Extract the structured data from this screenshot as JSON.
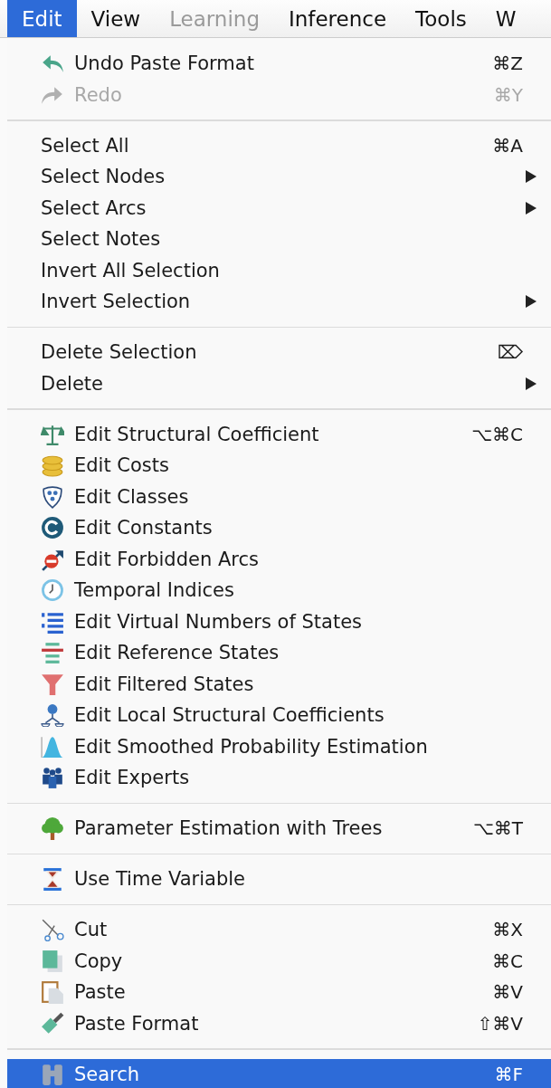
{
  "menubar": [
    {
      "label": "Edit",
      "selected": true,
      "disabled": false
    },
    {
      "label": "View",
      "selected": false,
      "disabled": false
    },
    {
      "label": "Learning",
      "selected": false,
      "disabled": true
    },
    {
      "label": "Inference",
      "selected": false,
      "disabled": false
    },
    {
      "label": "Tools",
      "selected": false,
      "disabled": false
    },
    {
      "label": "W",
      "selected": false,
      "disabled": false
    }
  ],
  "menu": {
    "sections": [
      {
        "items": [
          {
            "kind": "command",
            "label": "Undo Paste Format",
            "shortcut": "⌘Z",
            "disabled": false,
            "selected": false
          },
          {
            "kind": "command",
            "label": "Redo",
            "shortcut": "⌘Y",
            "disabled": true,
            "selected": false
          }
        ]
      },
      {
        "items": [
          {
            "kind": "command",
            "label": "Select All",
            "shortcut": "⌘A",
            "disabled": false,
            "selected": false
          },
          {
            "kind": "submenu",
            "label": "Select Nodes",
            "disabled": false,
            "selected": false
          },
          {
            "kind": "submenu",
            "label": "Select Arcs",
            "disabled": false,
            "selected": false
          },
          {
            "kind": "command",
            "label": "Select Notes",
            "disabled": false,
            "selected": false
          },
          {
            "kind": "command",
            "label": "Invert All Selection",
            "disabled": false,
            "selected": false
          },
          {
            "kind": "submenu",
            "label": "Invert Selection",
            "disabled": false,
            "selected": false
          }
        ]
      },
      {
        "items": [
          {
            "kind": "command",
            "label": "Delete Selection",
            "shortcut": "⌦",
            "disabled": false,
            "selected": false
          },
          {
            "kind": "submenu",
            "label": "Delete",
            "disabled": false,
            "selected": false
          }
        ]
      },
      {
        "items": [
          {
            "kind": "command",
            "label": "Edit Structural Coefficient",
            "shortcut": "⌥⌘C",
            "disabled": false,
            "selected": false
          },
          {
            "kind": "command",
            "label": "Edit Costs",
            "disabled": false,
            "selected": false
          },
          {
            "kind": "command",
            "label": "Edit Classes",
            "disabled": false,
            "selected": false
          },
          {
            "kind": "command",
            "label": "Edit Constants",
            "disabled": false,
            "selected": false
          },
          {
            "kind": "command",
            "label": "Edit Forbidden Arcs",
            "disabled": false,
            "selected": false
          },
          {
            "kind": "command",
            "label": "Temporal Indices",
            "disabled": false,
            "selected": false
          },
          {
            "kind": "command",
            "label": "Edit Virtual Numbers of States",
            "disabled": false,
            "selected": false
          },
          {
            "kind": "command",
            "label": "Edit Reference States",
            "disabled": false,
            "selected": false
          },
          {
            "kind": "command",
            "label": "Edit Filtered States",
            "disabled": false,
            "selected": false
          },
          {
            "kind": "command",
            "label": "Edit Local Structural Coefficients",
            "disabled": false,
            "selected": false
          },
          {
            "kind": "command",
            "label": "Edit Smoothed Probability Estimation",
            "disabled": false,
            "selected": false
          },
          {
            "kind": "command",
            "label": "Edit Experts",
            "disabled": false,
            "selected": false
          }
        ]
      },
      {
        "items": [
          {
            "kind": "command",
            "label": "Parameter Estimation with Trees",
            "shortcut": "⌥⌘T",
            "disabled": false,
            "selected": false
          }
        ]
      },
      {
        "items": [
          {
            "kind": "command",
            "label": "Use Time Variable",
            "disabled": false,
            "selected": false
          }
        ]
      },
      {
        "items": [
          {
            "kind": "command",
            "label": "Cut",
            "shortcut": "⌘X",
            "disabled": false,
            "selected": false
          },
          {
            "kind": "command",
            "label": "Copy",
            "shortcut": "⌘C",
            "disabled": false,
            "selected": false
          },
          {
            "kind": "command",
            "label": "Paste",
            "shortcut": "⌘V",
            "disabled": false,
            "selected": false
          },
          {
            "kind": "command",
            "label": "Paste Format",
            "shortcut": "⇧⌘V",
            "disabled": false,
            "selected": false
          }
        ]
      },
      {
        "items": [
          {
            "kind": "command",
            "label": "Search",
            "shortcut": "⌘F",
            "disabled": false,
            "selected": true
          }
        ]
      }
    ]
  }
}
